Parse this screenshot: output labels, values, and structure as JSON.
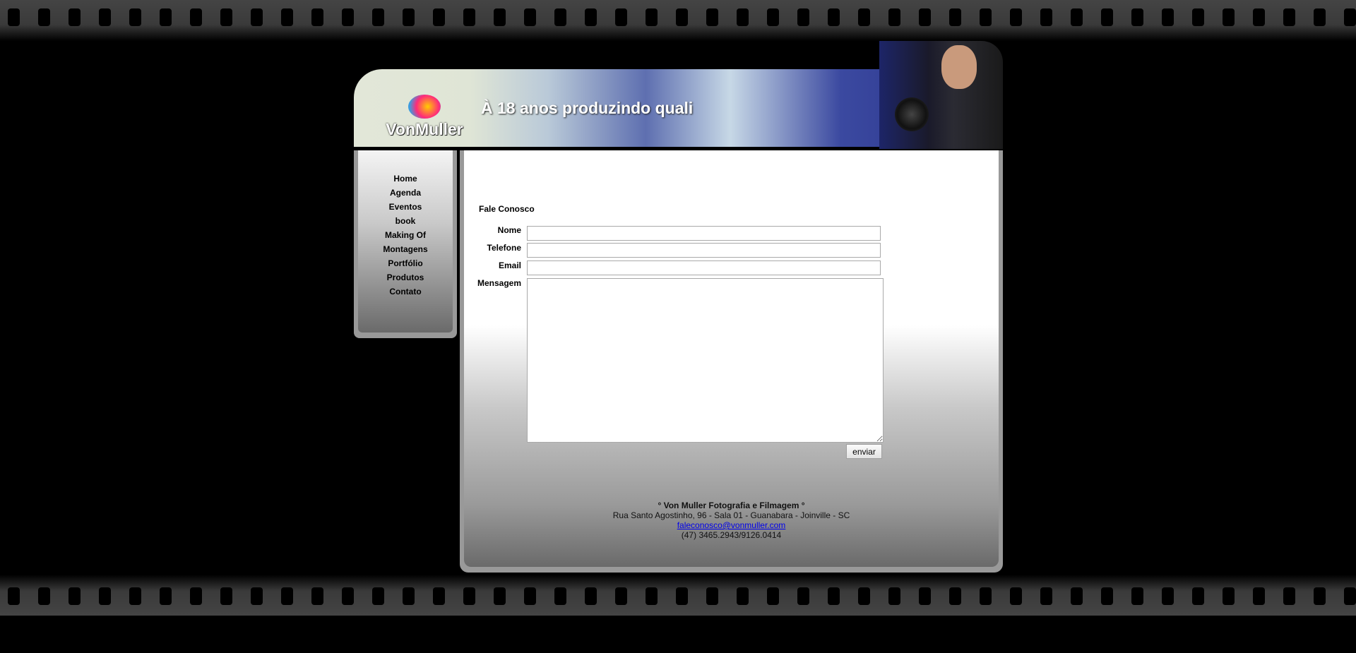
{
  "header": {
    "logo_text": "VonMuller",
    "slogan": "À 18 anos produzindo quali"
  },
  "nav": {
    "items": [
      {
        "label": "Home"
      },
      {
        "label": "Agenda"
      },
      {
        "label": "Eventos"
      },
      {
        "label": "book"
      },
      {
        "label": "Making Of"
      },
      {
        "label": "Montagens"
      },
      {
        "label": "Portfólio"
      },
      {
        "label": "Produtos"
      },
      {
        "label": "Contato"
      }
    ]
  },
  "form": {
    "title": "Fale Conosco",
    "fields": {
      "nome": {
        "label": "Nome",
        "value": ""
      },
      "telefone": {
        "label": "Telefone",
        "value": ""
      },
      "email": {
        "label": "Email",
        "value": ""
      },
      "mensagem": {
        "label": "Mensagem",
        "value": ""
      }
    },
    "submit_label": "enviar"
  },
  "footer": {
    "company": "° Von Muller Fotografia e Filmagem °",
    "address": "Rua Santo Agostinho, 96 - Sala 01 - Guanabara - Joinville - SC",
    "email": "faleconosco@vonmuller.com",
    "phone": "(47) 3465.2943/9126.0414"
  },
  "colors": {
    "link": "#0000ee",
    "background": "#000000"
  }
}
